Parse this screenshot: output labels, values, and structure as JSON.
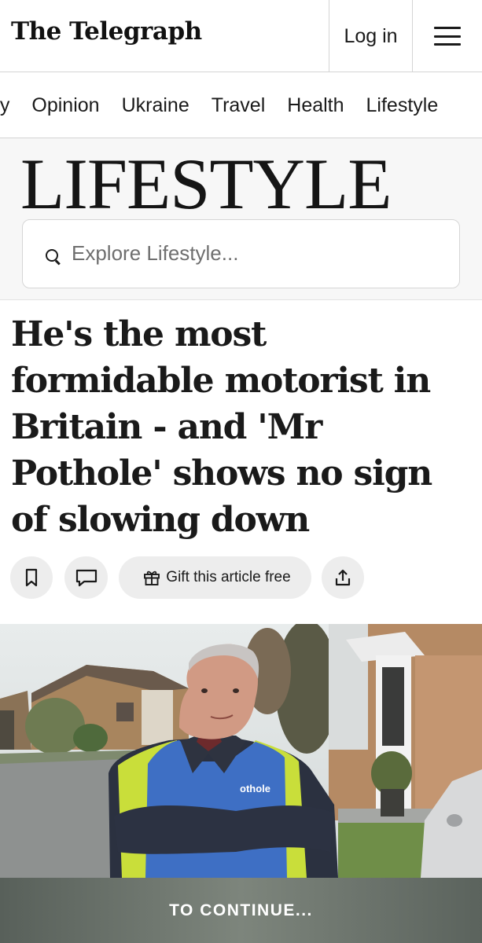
{
  "header": {
    "logo": "The Telegraph",
    "login_label": "Log in"
  },
  "nav": {
    "items": [
      "ey",
      "Opinion",
      "Ukraine",
      "Travel",
      "Health",
      "Lifestyle"
    ]
  },
  "section": {
    "title": "LIFESTYLE",
    "search_placeholder": "Explore Lifestyle..."
  },
  "article": {
    "headline": "He's the most formidable motorist in Britain - and 'Mr Pothole' shows no sign of slowing down",
    "gift_label": "Gift this article free",
    "vest_text": "othole"
  },
  "icons": {
    "menu": "hamburger-icon",
    "search": "search-icon",
    "bookmark": "bookmark-icon",
    "comment": "comment-icon",
    "gift": "gift-icon",
    "share": "share-icon"
  },
  "continue_label": "TO CONTINUE..."
}
